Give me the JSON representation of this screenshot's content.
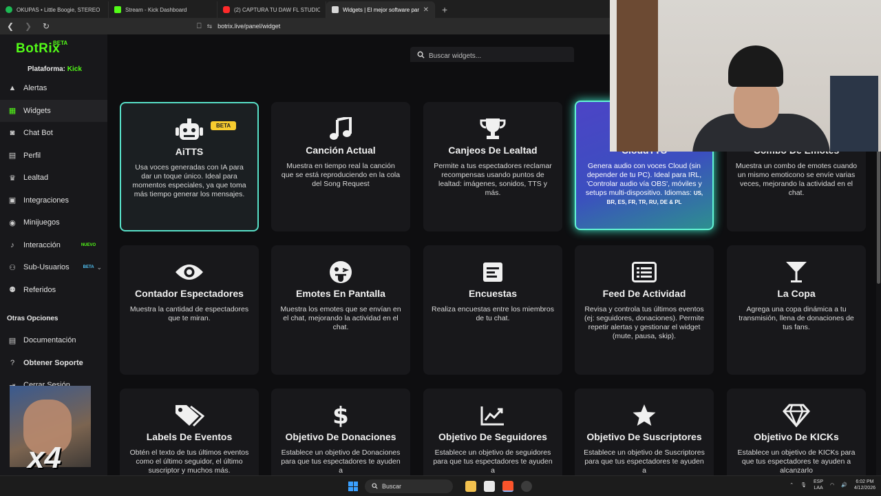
{
  "browser": {
    "tabs": [
      {
        "title": "OKUPAS • Little Boogie, STEREO",
        "color": "#1db954"
      },
      {
        "title": "Stream - Kick Dashboard",
        "color": "#53fc18"
      },
      {
        "title": "(2) CAPTURA TU DAW FL STUDIO EN",
        "color": "#ff2a2a"
      },
      {
        "title": "Widgets | El mejor software para",
        "color": "#d8d8d8"
      }
    ],
    "url": "botrix.live/panel/widget"
  },
  "sidebar": {
    "brand": "BotRix",
    "brand_badge": "BETA",
    "platform_label": "Plataforma:",
    "platform_value": "Kick",
    "items": [
      {
        "label": "Alertas",
        "icon": "alert-icon"
      },
      {
        "label": "Widgets",
        "icon": "grid-icon"
      },
      {
        "label": "Chat Bot",
        "icon": "robot-icon"
      },
      {
        "label": "Perfil",
        "icon": "id-card-icon"
      },
      {
        "label": "Lealtad",
        "icon": "trophy-icon"
      },
      {
        "label": "Integraciones",
        "icon": "puzzle-icon"
      },
      {
        "label": "Minijuegos",
        "icon": "gamepad-icon"
      },
      {
        "label": "Interacción",
        "icon": "music-icon",
        "tag": "NUEVO"
      },
      {
        "label": "Sub-Usuarios",
        "icon": "users-icon",
        "tag": "BETA"
      },
      {
        "label": "Referidos",
        "icon": "user-group-icon"
      }
    ],
    "other_title": "Otras Opciones",
    "other_items": [
      {
        "label": "Documentación",
        "icon": "document-icon"
      },
      {
        "label": "Obtener Soporte",
        "icon": "help-icon"
      },
      {
        "label": "Cerrar Sesión",
        "icon": "logout-icon"
      }
    ]
  },
  "search": {
    "placeholder": "Buscar widgets..."
  },
  "widgets": [
    {
      "title": "AiTTS",
      "badge": "BETA",
      "desc": "Usa voces generadas con IA para dar un toque único. Ideal para momentos especiales, ya que toma más tiempo generar los mensajes."
    },
    {
      "title": "Canción Actual",
      "desc": "Muestra en tiempo real la canción que se está reproduciendo en la cola del Song Request"
    },
    {
      "title": "Canjeos De Lealtad",
      "desc": "Permite a tus espectadores reclamar recompensas usando puntos de lealtad: imágenes, sonidos, TTS y más."
    },
    {
      "title": "CloudTTS",
      "desc": "Genera audio con voces Cloud (sin depender de tu PC). Ideal para IRL, 'Controlar audio vía OBS', móviles y setups multi-dispositivo. Idiomas:",
      "langs": "US, BR, ES, FR, TR, RU, DE & PL"
    },
    {
      "title": "Combo De Emotes",
      "desc": "Muestra un combo de emotes cuando un mismo emoticono se envíe varias veces, mejorando la actividad en el chat."
    },
    {
      "title": "Contador Espectadores",
      "desc": "Muestra la cantidad de espectadores que te miran."
    },
    {
      "title": "Emotes En Pantalla",
      "desc": "Muestra los emotes que se envían en el chat, mejorando la actividad en el chat."
    },
    {
      "title": "Encuestas",
      "desc": "Realiza encuestas entre los miembros de tu chat."
    },
    {
      "title": "Feed De Actividad",
      "desc": "Revisa y controla tus últimos eventos (ej: seguidores, donaciones). Permite repetir alertas y gestionar el widget (mute, pausa, skip)."
    },
    {
      "title": "La Copa",
      "desc": "Agrega una copa dinámica a tu transmisión, llena de donaciones de tus fans."
    },
    {
      "title": "Labels De Eventos",
      "desc": "Obtén el texto de tus últimos eventos como el último seguidor, el último suscriptor y muchos más."
    },
    {
      "title": "Objetivo De Donaciones",
      "desc": "Establece un objetivo de Donaciones para que tus espectadores te ayuden a"
    },
    {
      "title": "Objetivo De Seguidores",
      "desc": "Establece un objetivo de seguidores para que tus espectadores te ayuden a"
    },
    {
      "title": "Objetivo De Suscriptores",
      "desc": "Establece un objetivo de Suscriptores para que tus espectadores te ayuden a"
    },
    {
      "title": "Objetivo De KICKs",
      "desc": "Establece un objetivo de KICKs para que tus espectadores te ayuden a alcanzarlo"
    }
  ],
  "overlay": {
    "multiplier": "x4"
  },
  "taskbar": {
    "search_label": "Buscar",
    "lang_top": "ESP",
    "lang_bottom": "LAA",
    "time": "6:02 PM",
    "date": "4/12/2026"
  },
  "colors": {
    "brand": "#53fc18",
    "selected_border": "#58e0c8",
    "beta_badge": "#f7cc2f"
  }
}
